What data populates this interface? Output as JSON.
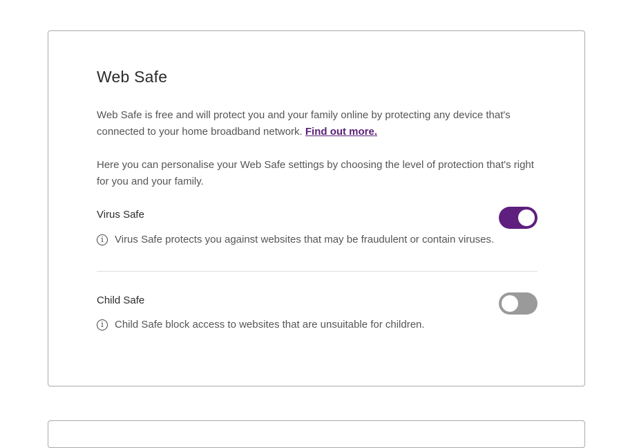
{
  "web_safe": {
    "title": "Web Safe",
    "intro_text": "Web Safe is free and will protect you and your family online by protecting any device that's connected to your home broadband network.",
    "find_out_more_link": "Find out more.",
    "personalise_text": "Here you can personalise your Web Safe settings by choosing the level of protection that's right for you and your family.",
    "virus_safe": {
      "label": "Virus Safe",
      "enabled": true,
      "description": "Virus Safe protects you against websites that may be fraudulent or contain viruses."
    },
    "child_safe": {
      "label": "Child Safe",
      "enabled": false,
      "description": "Child Safe block access to websites that are unsuitable for children."
    }
  },
  "icons": {
    "info_glyph": "i"
  },
  "colors": {
    "accent": "#5f1f7f",
    "toggle_off": "#9a9a9a",
    "link": "#5a1f78"
  }
}
